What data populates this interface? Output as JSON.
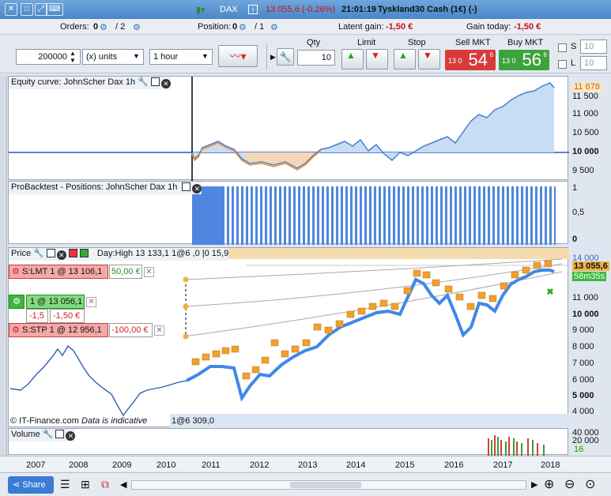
{
  "titlebar": {
    "instrument": "DAX",
    "change": "13 055,6 (-0,26%)",
    "time": "21:01:19",
    "name": "Tyskland30 Cash (1€) (-)"
  },
  "infobar": {
    "orders_label": "Orders:",
    "orders_a": "0",
    "orders_b": "/ 2",
    "position_label": "Position:",
    "position_a": "0",
    "position_b": "/ 1",
    "latent_label": "Latent gain:",
    "latent_value": "-1,50 €",
    "today_label": "Gain today:",
    "today_value": "-1,50 €"
  },
  "toolbar": {
    "quantity": "200000",
    "units": "(x) units",
    "timeframe": "1 hour",
    "qty_label": "Qty",
    "qty_value": "10",
    "limit_label": "Limit",
    "stop_label": "Stop",
    "sell_label": "Sell MKT",
    "sell_prefix": "13 0",
    "sell_big": "54",
    "sell_sup": "6",
    "buy_label": "Buy MKT",
    "buy_prefix": "13 0",
    "buy_big": "56",
    "buy_sup": "6",
    "s_label": "S",
    "s_value": "10",
    "l_label": "L",
    "l_value": "10"
  },
  "equity": {
    "title": "Equity curve: JohnScher Dax 1h",
    "ticks": [
      "11 678",
      "11 500",
      "11 000",
      "10 500",
      "10 000",
      "9 500"
    ]
  },
  "positions": {
    "title": "ProBacktest - Positions: JohnScher Dax 1h",
    "ticks": [
      "1",
      "0,5",
      "0"
    ]
  },
  "price": {
    "title": "Price",
    "dayhigh": "Day:High 13 133,1",
    "dayrange": "1@6 ,0 |0 15,9",
    "footer_left": "© IT-Finance.com",
    "footer_note": "Data is indicative",
    "footer_mid": "1@6 309,0",
    "lmt_label": "S:LMT  1 @ 13 106,1",
    "lmt_value": "50,00 €",
    "pos_label": "1 @ 13 056,1",
    "pos_a": "-1,5",
    "pos_b": "-1,50 €",
    "stp_label": "S:STP  1 @ 12 956,1",
    "stp_value": "-100,00 €",
    "ticks": [
      "14 000",
      "13 055,6",
      "12 000",
      "11 000",
      "10 000",
      "9 000",
      "8 000",
      "7 000",
      "6 000",
      "5 000",
      "4 000"
    ],
    "countdown": "58m35s"
  },
  "volume": {
    "title": "Volume",
    "ticks": [
      "40 000",
      "20 000",
      "16"
    ]
  },
  "xaxis": [
    "2007",
    "2008",
    "2009",
    "2010",
    "2011",
    "2012",
    "2013",
    "2014",
    "2015",
    "2016",
    "2017",
    "2018"
  ],
  "bottom": {
    "share": "Share"
  }
}
